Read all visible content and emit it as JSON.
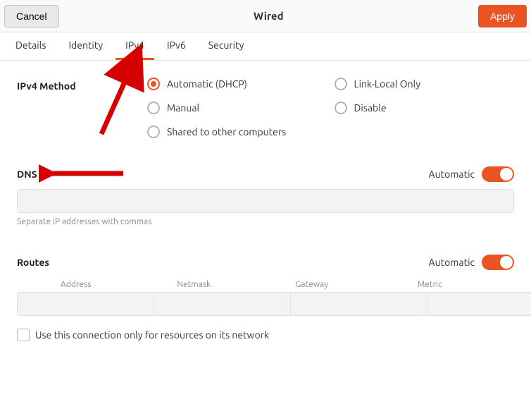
{
  "header": {
    "cancel_label": "Cancel",
    "title": "Wired",
    "apply_label": "Apply"
  },
  "tabs": [
    {
      "id": "details",
      "label": "Details",
      "active": false
    },
    {
      "id": "identity",
      "label": "Identity",
      "active": false
    },
    {
      "id": "ipv4",
      "label": "IPv4",
      "active": true
    },
    {
      "id": "ipv6",
      "label": "IPv6",
      "active": false
    },
    {
      "id": "security",
      "label": "Security",
      "active": false
    }
  ],
  "ipv4": {
    "method_label": "IPv4 Method",
    "options": [
      {
        "id": "dhcp",
        "label": "Automatic (DHCP)",
        "selected": true
      },
      {
        "id": "linklocal",
        "label": "Link-Local Only",
        "selected": false
      },
      {
        "id": "manual",
        "label": "Manual",
        "selected": false
      },
      {
        "id": "disable",
        "label": "Disable",
        "selected": false
      },
      {
        "id": "shared",
        "label": "Shared to other computers",
        "selected": false
      }
    ]
  },
  "dns": {
    "title": "DNS",
    "auto_label": "Automatic",
    "value": "",
    "hint": "Separate IP addresses with commas"
  },
  "routes": {
    "title": "Routes",
    "auto_label": "Automatic",
    "columns": {
      "address": "Address",
      "netmask": "Netmask",
      "gateway": "Gateway",
      "metric": "Metric"
    },
    "row": {
      "address": "",
      "netmask": "",
      "gateway": "",
      "metric": ""
    },
    "trash_icon": "trash-icon",
    "only_for_resources_label": "Use this connection only for resources on its network"
  },
  "colors": {
    "accent": "#e95420"
  }
}
